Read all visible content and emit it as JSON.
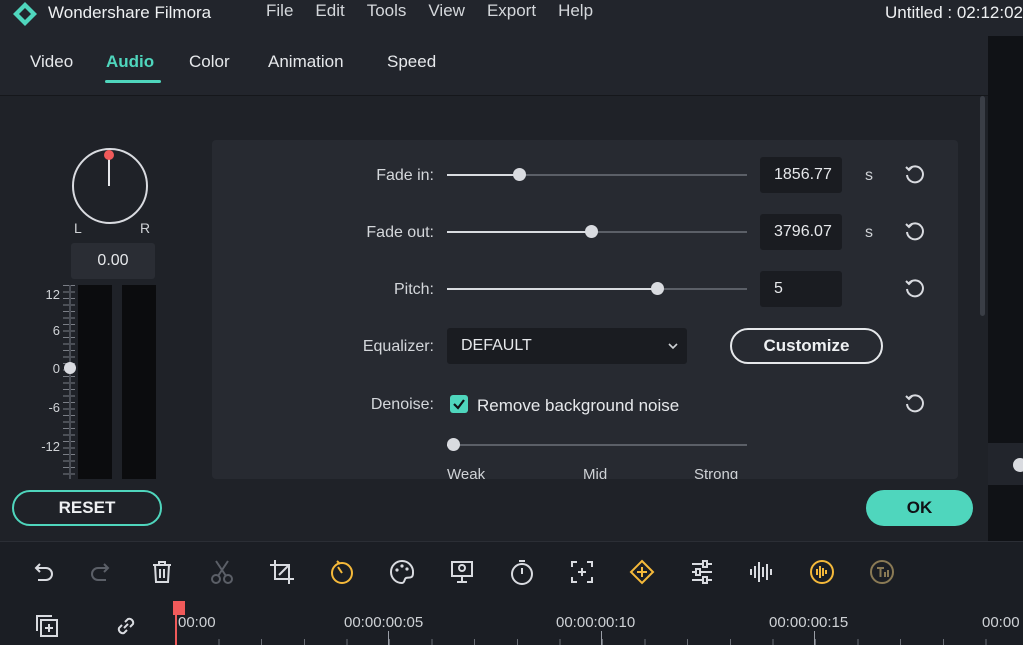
{
  "titlebar": {
    "app_name": "Wondershare Filmora",
    "menu": [
      "File",
      "Edit",
      "Tools",
      "View",
      "Export",
      "Help"
    ],
    "project_title": "Untitled : 02:12:02"
  },
  "tabs": [
    "Video",
    "Audio",
    "Color",
    "Animation",
    "Speed"
  ],
  "active_tab": "Audio",
  "meter": {
    "left_label": "L",
    "right_label": "R",
    "pan_value": "0.00",
    "db_labels": [
      "12",
      "6",
      "0",
      "-6",
      "-12"
    ]
  },
  "settings": {
    "fade_in": {
      "label": "Fade in:",
      "value": "1856.77",
      "unit": "s",
      "slider_fraction": 0.24
    },
    "fade_out": {
      "label": "Fade out:",
      "value": "3796.07",
      "unit": "s",
      "slider_fraction": 0.48
    },
    "pitch": {
      "label": "Pitch:",
      "value": "5",
      "slider_fraction": 0.7
    },
    "equalizer": {
      "label": "Equalizer:",
      "value": "DEFAULT",
      "customize_label": "Customize"
    },
    "denoise": {
      "label": "Denoise:",
      "checkbox_label": "Remove background noise",
      "checked": true,
      "slider_fraction": 0.02,
      "levels": [
        "Weak",
        "Mid",
        "Strong"
      ]
    }
  },
  "buttons": {
    "reset": "RESET",
    "ok": "OK"
  },
  "toolbar_icons": [
    "undo-icon",
    "redo-icon",
    "delete-icon",
    "cut-icon",
    "crop-icon",
    "speed-icon",
    "color-palette-icon",
    "freeze-frame-icon",
    "duration-icon",
    "zoom-fit-icon",
    "keyframe-icon",
    "adjust-icon",
    "audio-waveform-icon",
    "audio-stretch-icon",
    "text-to-speech-icon"
  ],
  "timeline": {
    "timecodes": [
      "00:00",
      "00:00:00:05",
      "00:00:00:10",
      "00:00:00:15",
      "00:00"
    ]
  },
  "colors": {
    "accent": "#4fd6bd",
    "playhead": "#f05a5a",
    "keyframe": "#f5b93a"
  }
}
